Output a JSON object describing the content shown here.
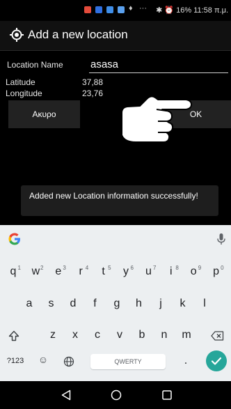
{
  "status_bar": {
    "text": "✱ ⏰ 16% 11:58 π.μ.",
    "more": "···",
    "icon_colors": [
      "#e34b3b",
      "#2f6fe0",
      "#3f8ee8",
      "#5aa0ee"
    ]
  },
  "app_bar": {
    "title": "Add a new location",
    "icon": "location-target-icon"
  },
  "form": {
    "name_label": "Location Name",
    "name_value": "asasa",
    "latitude_label": "Latitude",
    "latitude_value": "37,88",
    "longitude_label": "Longitude",
    "longitude_value": "23,76",
    "cancel_label": "Ακυρο",
    "ok_label": "OK"
  },
  "toast": {
    "message": "Added new Location information successfully!"
  },
  "keyboard": {
    "row1": [
      {
        "k": "q",
        "h": "1"
      },
      {
        "k": "w",
        "h": "2"
      },
      {
        "k": "e",
        "h": "3"
      },
      {
        "k": "r",
        "h": "4"
      },
      {
        "k": "t",
        "h": "5"
      },
      {
        "k": "y",
        "h": "6"
      },
      {
        "k": "u",
        "h": "7"
      },
      {
        "k": "i",
        "h": "8"
      },
      {
        "k": "o",
        "h": "9"
      },
      {
        "k": "p",
        "h": "0"
      }
    ],
    "row2": [
      "a",
      "s",
      "d",
      "f",
      "g",
      "h",
      "j",
      "k",
      "l"
    ],
    "row3": [
      "z",
      "x",
      "c",
      "v",
      "b",
      "n",
      "m"
    ],
    "symbols_label": "?123",
    "space_label": "QWERTY",
    "period": "."
  },
  "colors": {
    "accent": "#26a69a",
    "keyboard_bg": "#eceff1",
    "app_bg": "#000000"
  }
}
